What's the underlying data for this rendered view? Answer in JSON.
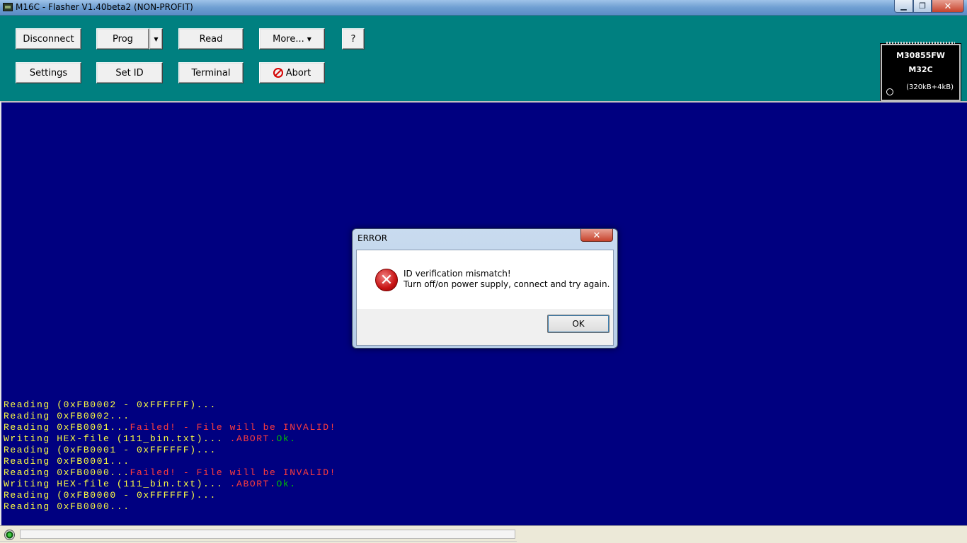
{
  "window": {
    "title": "M16C - Flasher  V1.40beta2 (NON-PROFIT)",
    "minimize_glyph": "▁",
    "maximize_glyph": "❐",
    "close_glyph": "✕"
  },
  "toolbar": {
    "disconnect_label": "Disconnect",
    "prog_label": "Prog",
    "prog_dropdown_glyph": "▼",
    "read_label": "Read",
    "more_label": "More...",
    "more_dropdown_glyph": "▼",
    "help_label": "?",
    "settings_label": "Settings",
    "setid_label": "Set ID",
    "terminal_label": "Terminal",
    "abort_label": "Abort"
  },
  "chip": {
    "part_number": "M30855FW",
    "family": "M32C",
    "memory": "(320kB+4kB)"
  },
  "console": {
    "lines": [
      [
        {
          "t": "Reading (0xFB0002 - 0xFFFFFF)...",
          "c": "y"
        }
      ],
      [
        {
          "t": "Reading 0xFB0002...",
          "c": "y"
        }
      ],
      [
        {
          "t": "Reading 0xFB0001...",
          "c": "y"
        },
        {
          "t": "Failed! - File will be INVALID!",
          "c": "r"
        }
      ],
      [
        {
          "t": "Writing HEX-file (111_bin.txt)... ",
          "c": "y"
        },
        {
          "t": ".ABORT.",
          "c": "r"
        },
        {
          "t": "Ok.",
          "c": "g"
        }
      ],
      [
        {
          "t": "Reading (0xFB0001 - 0xFFFFFF)...",
          "c": "y"
        }
      ],
      [
        {
          "t": "Reading 0xFB0001...",
          "c": "y"
        }
      ],
      [
        {
          "t": "Reading 0xFB0000...",
          "c": "y"
        },
        {
          "t": "Failed! - File will be INVALID!",
          "c": "r"
        }
      ],
      [
        {
          "t": "Writing HEX-file (111_bin.txt)... ",
          "c": "y"
        },
        {
          "t": ".ABORT.",
          "c": "r"
        },
        {
          "t": "Ok.",
          "c": "g"
        }
      ],
      [
        {
          "t": "Reading (0xFB0000 - 0xFFFFFF)...",
          "c": "y"
        }
      ],
      [
        {
          "t": "Reading 0xFB0000...",
          "c": "y"
        }
      ]
    ]
  },
  "dialog": {
    "title": "ERROR",
    "close_glyph": "✕",
    "icon_glyph": "✕",
    "message_line1": "ID verification mismatch!",
    "message_line2": "Turn off/on power supply, connect and try again.",
    "ok_label": "OK"
  },
  "status": {
    "progress": 0
  }
}
